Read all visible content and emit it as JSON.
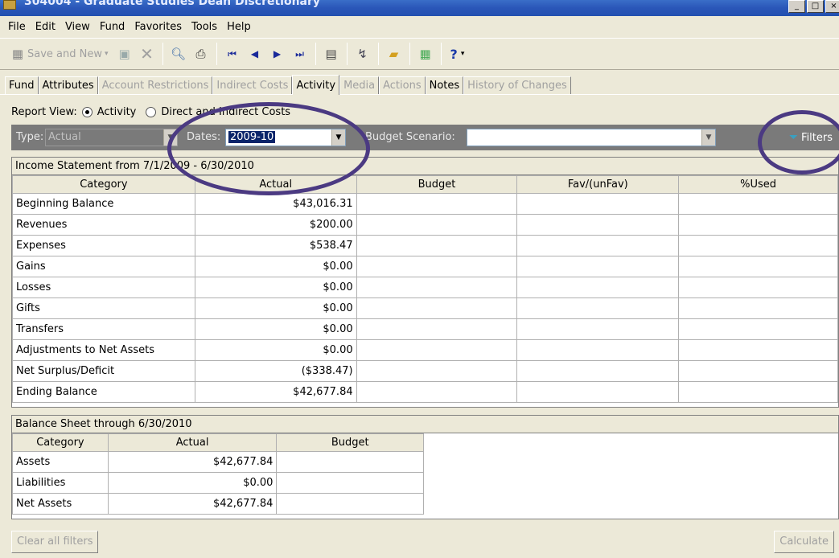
{
  "window": {
    "title": "304004 - Graduate Studies Dean Discretionary"
  },
  "menu": [
    "File",
    "Edit",
    "View",
    "Fund",
    "Favorites",
    "Tools",
    "Help"
  ],
  "toolbar": {
    "save_new_label": "Save and New",
    "help_label": "?"
  },
  "tabs": [
    {
      "label": "Fund",
      "state": "normal"
    },
    {
      "label": "Attributes",
      "state": "normal"
    },
    {
      "label": "Account Restrictions",
      "state": "disabled"
    },
    {
      "label": "Indirect Costs",
      "state": "disabled"
    },
    {
      "label": "Activity",
      "state": "active"
    },
    {
      "label": "Media",
      "state": "disabled"
    },
    {
      "label": "Actions",
      "state": "disabled"
    },
    {
      "label": "Notes",
      "state": "normal"
    },
    {
      "label": "History of Changes",
      "state": "disabled"
    }
  ],
  "report_view": {
    "label": "Report View:",
    "option1": "Activity",
    "option2": "Direct and Indirect Costs",
    "selected": "Activity"
  },
  "filters": {
    "type_label": "Type:",
    "type_value": "Actual",
    "dates_label": "Dates:",
    "dates_value": "2009-10",
    "budget_label": "Budget Scenario:",
    "budget_value": "",
    "filters_button": "Filters"
  },
  "income_statement": {
    "caption": "Income Statement from 7/1/2009 - 6/30/2010",
    "columns": [
      "Category",
      "Actual",
      "Budget",
      "Fav/(unFav)",
      "%Used"
    ],
    "rows": [
      [
        "Beginning Balance",
        "$43,016.31",
        "",
        "",
        ""
      ],
      [
        "Revenues",
        "$200.00",
        "",
        "",
        ""
      ],
      [
        "Expenses",
        "$538.47",
        "",
        "",
        ""
      ],
      [
        "Gains",
        "$0.00",
        "",
        "",
        ""
      ],
      [
        "Losses",
        "$0.00",
        "",
        "",
        ""
      ],
      [
        "Gifts",
        "$0.00",
        "",
        "",
        ""
      ],
      [
        "Transfers",
        "$0.00",
        "",
        "",
        ""
      ],
      [
        "Adjustments to Net Assets",
        "$0.00",
        "",
        "",
        ""
      ],
      [
        "Net Surplus/Deficit",
        "($338.47)",
        "",
        "",
        ""
      ],
      [
        "Ending Balance",
        "$42,677.84",
        "",
        "",
        ""
      ]
    ]
  },
  "balance_sheet": {
    "caption": "Balance Sheet through 6/30/2010",
    "columns": [
      "Category",
      "Actual",
      "Budget"
    ],
    "rows": [
      [
        "Assets",
        "$42,677.84",
        ""
      ],
      [
        "Liabilities",
        "$0.00",
        ""
      ],
      [
        "Net Assets",
        "$42,677.84",
        ""
      ]
    ]
  },
  "buttons": {
    "clear_filters": "Clear all filters",
    "calculate": "Calculate"
  },
  "colors": {
    "annotation": "#4b3a82",
    "filter_bar": "#7a7a7a",
    "title_bar": "#2a56b8"
  }
}
